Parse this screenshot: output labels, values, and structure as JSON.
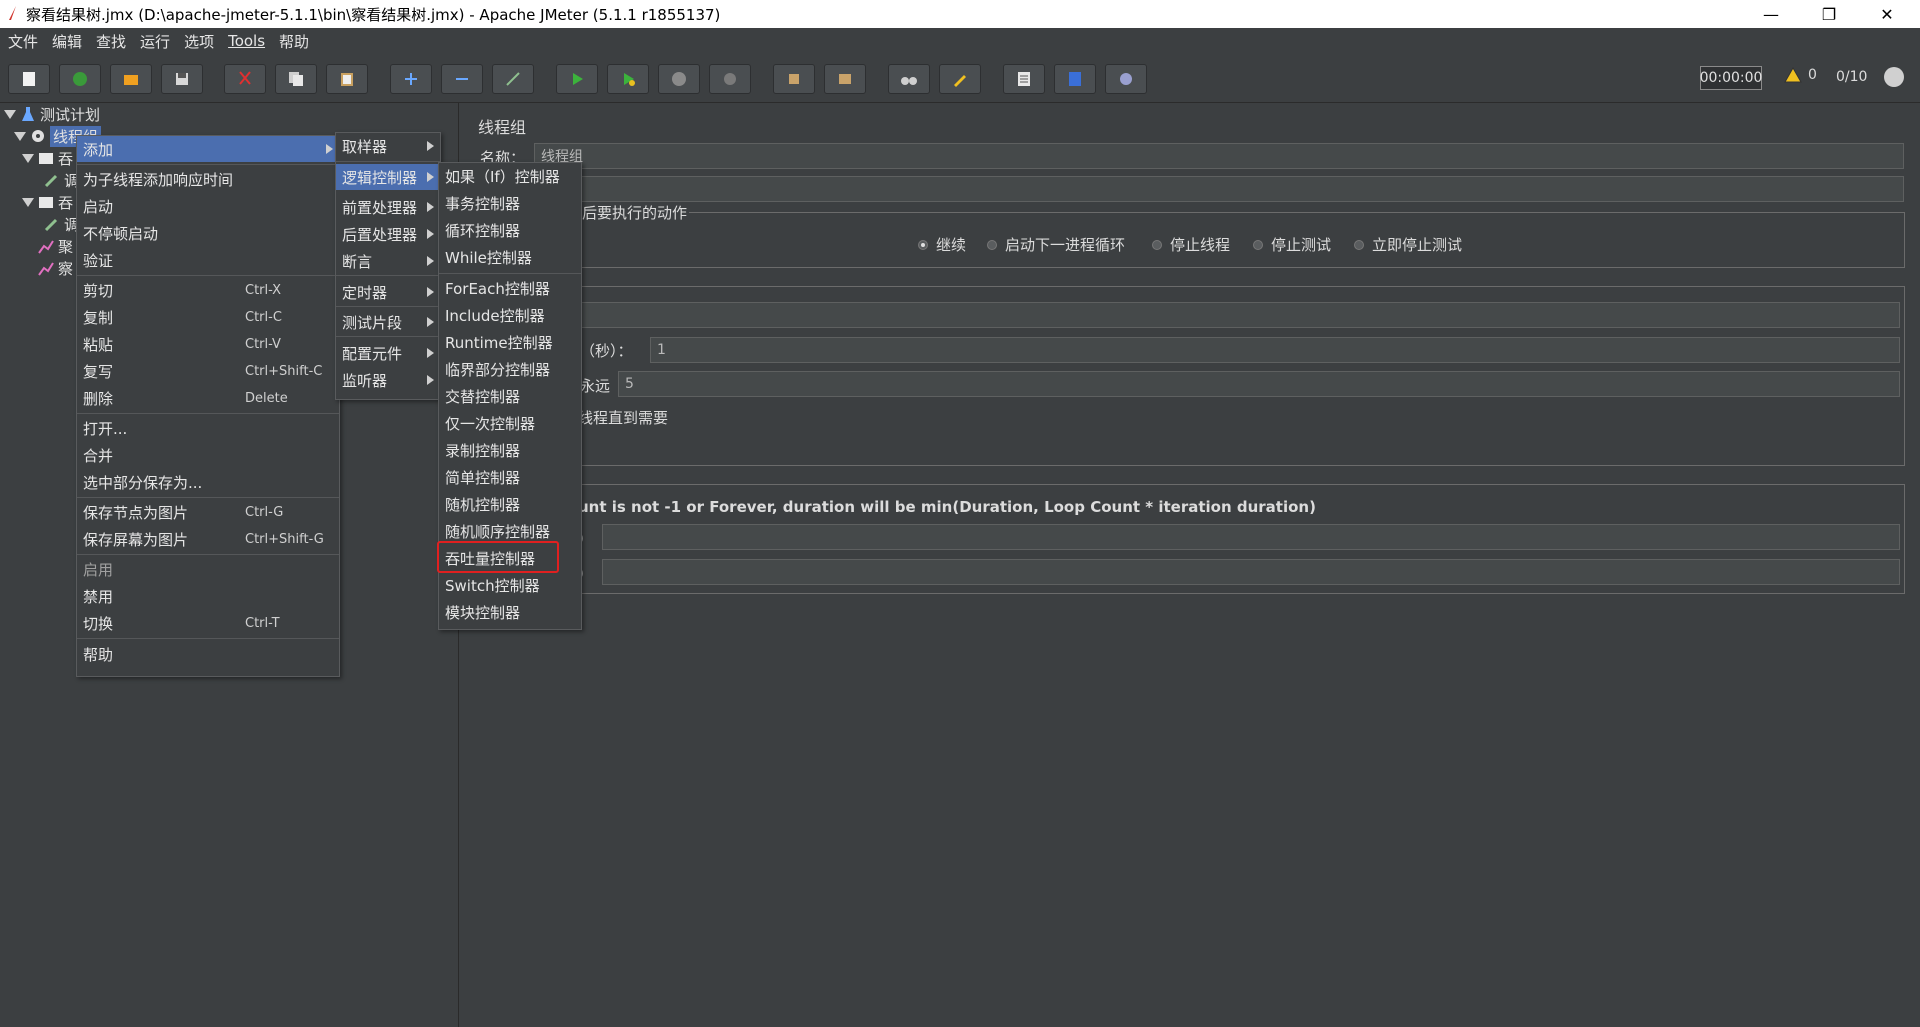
{
  "window": {
    "title": "察看结果树.jmx (D:\\apache-jmeter-5.1.1\\bin\\察看结果树.jmx) - Apache JMeter (5.1.1 r1855137)",
    "minimize": "—",
    "maximize": "❐",
    "close": "✕"
  },
  "menubar": [
    "文件",
    "编辑",
    "查找",
    "运行",
    "选项",
    "Tools",
    "帮助"
  ],
  "status": {
    "timer": "00:00:00",
    "warnings": "0",
    "threads": "0/10"
  },
  "tree": {
    "test_plan": "测试计划",
    "thread_group": "线程组",
    "row3": "吞",
    "row4": "调",
    "row5": "吞",
    "row6": "调",
    "row7": "聚",
    "row8": "察"
  },
  "panel": {
    "title": "线程组",
    "name_label": "名称：",
    "name_value": "线程组",
    "action_group": "后要执行的动作",
    "radios": [
      "继续",
      "启动下一进程循环",
      "停止线程",
      "停止测试",
      "立即停止测试"
    ],
    "ramp_label": "（秒）：",
    "ramp_value": "1",
    "loop_label": "永远",
    "loop_value": "5",
    "delay_label": "线程直到需要",
    "note": "unt is not -1 or Forever, duration will be min(Duration, Loop Count * iteration duration)",
    "dur_label": "）",
    "startup_label": "）"
  },
  "context_menu": [
    {
      "label": "添加",
      "submenu": true
    },
    {
      "label": "为子线程添加响应时间"
    },
    {
      "label": "启动"
    },
    {
      "label": "不停顿启动"
    },
    {
      "label": "验证"
    },
    {
      "label": "剪切",
      "shortcut": "Ctrl-X"
    },
    {
      "label": "复制",
      "shortcut": "Ctrl-C"
    },
    {
      "label": "粘贴",
      "shortcut": "Ctrl-V"
    },
    {
      "label": "复写",
      "shortcut": "Ctrl+Shift-C"
    },
    {
      "label": "删除",
      "shortcut": "Delete"
    },
    {
      "label": "打开..."
    },
    {
      "label": "合并"
    },
    {
      "label": "选中部分保存为..."
    },
    {
      "label": "保存节点为图片",
      "shortcut": "Ctrl-G"
    },
    {
      "label": "保存屏幕为图片",
      "shortcut": "Ctrl+Shift-G"
    },
    {
      "label": "启用"
    },
    {
      "label": "禁用"
    },
    {
      "label": "切换",
      "shortcut": "Ctrl-T"
    },
    {
      "label": "帮助"
    }
  ],
  "add_menu": [
    "取样器",
    "逻辑控制器",
    "前置处理器",
    "后置处理器",
    "断言",
    "定时器",
    "测试片段",
    "配置元件",
    "监听器"
  ],
  "logic_menu": [
    "如果（If）控制器",
    "事务控制器",
    "循环控制器",
    "While控制器",
    "ForEach控制器",
    "Include控制器",
    "Runtime控制器",
    "临界部分控制器",
    "交替控制器",
    "仅一次控制器",
    "录制控制器",
    "简单控制器",
    "随机控制器",
    "随机顺序控制器",
    "吞吐量控制器",
    "Switch控制器",
    "模块控制器"
  ]
}
